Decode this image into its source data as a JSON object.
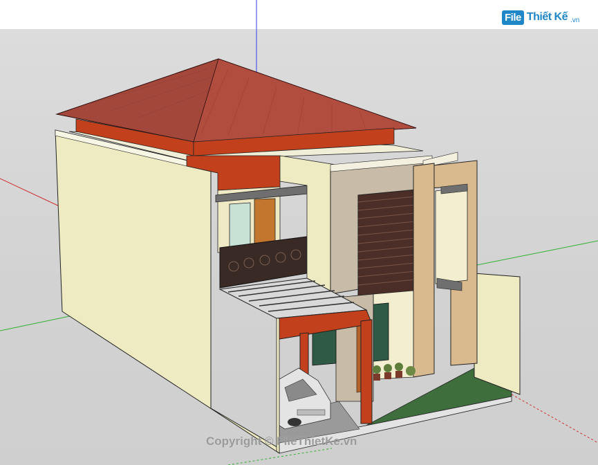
{
  "logo": {
    "badge": "File",
    "word": "Thiết Kế",
    "suffix": ".vn"
  },
  "watermark": {
    "text": "Copyright © FileThietKe.vn"
  },
  "colors": {
    "axis_blue": "#3a3af0",
    "axis_red": "#d03030",
    "axis_green": "#30b030",
    "roof": "#a3473b",
    "fascia": "#c2401c",
    "wall": "#eeebc3",
    "stone": "#c8bca8",
    "brick": "#d9b98e",
    "lawn": "#3f6e3d"
  }
}
